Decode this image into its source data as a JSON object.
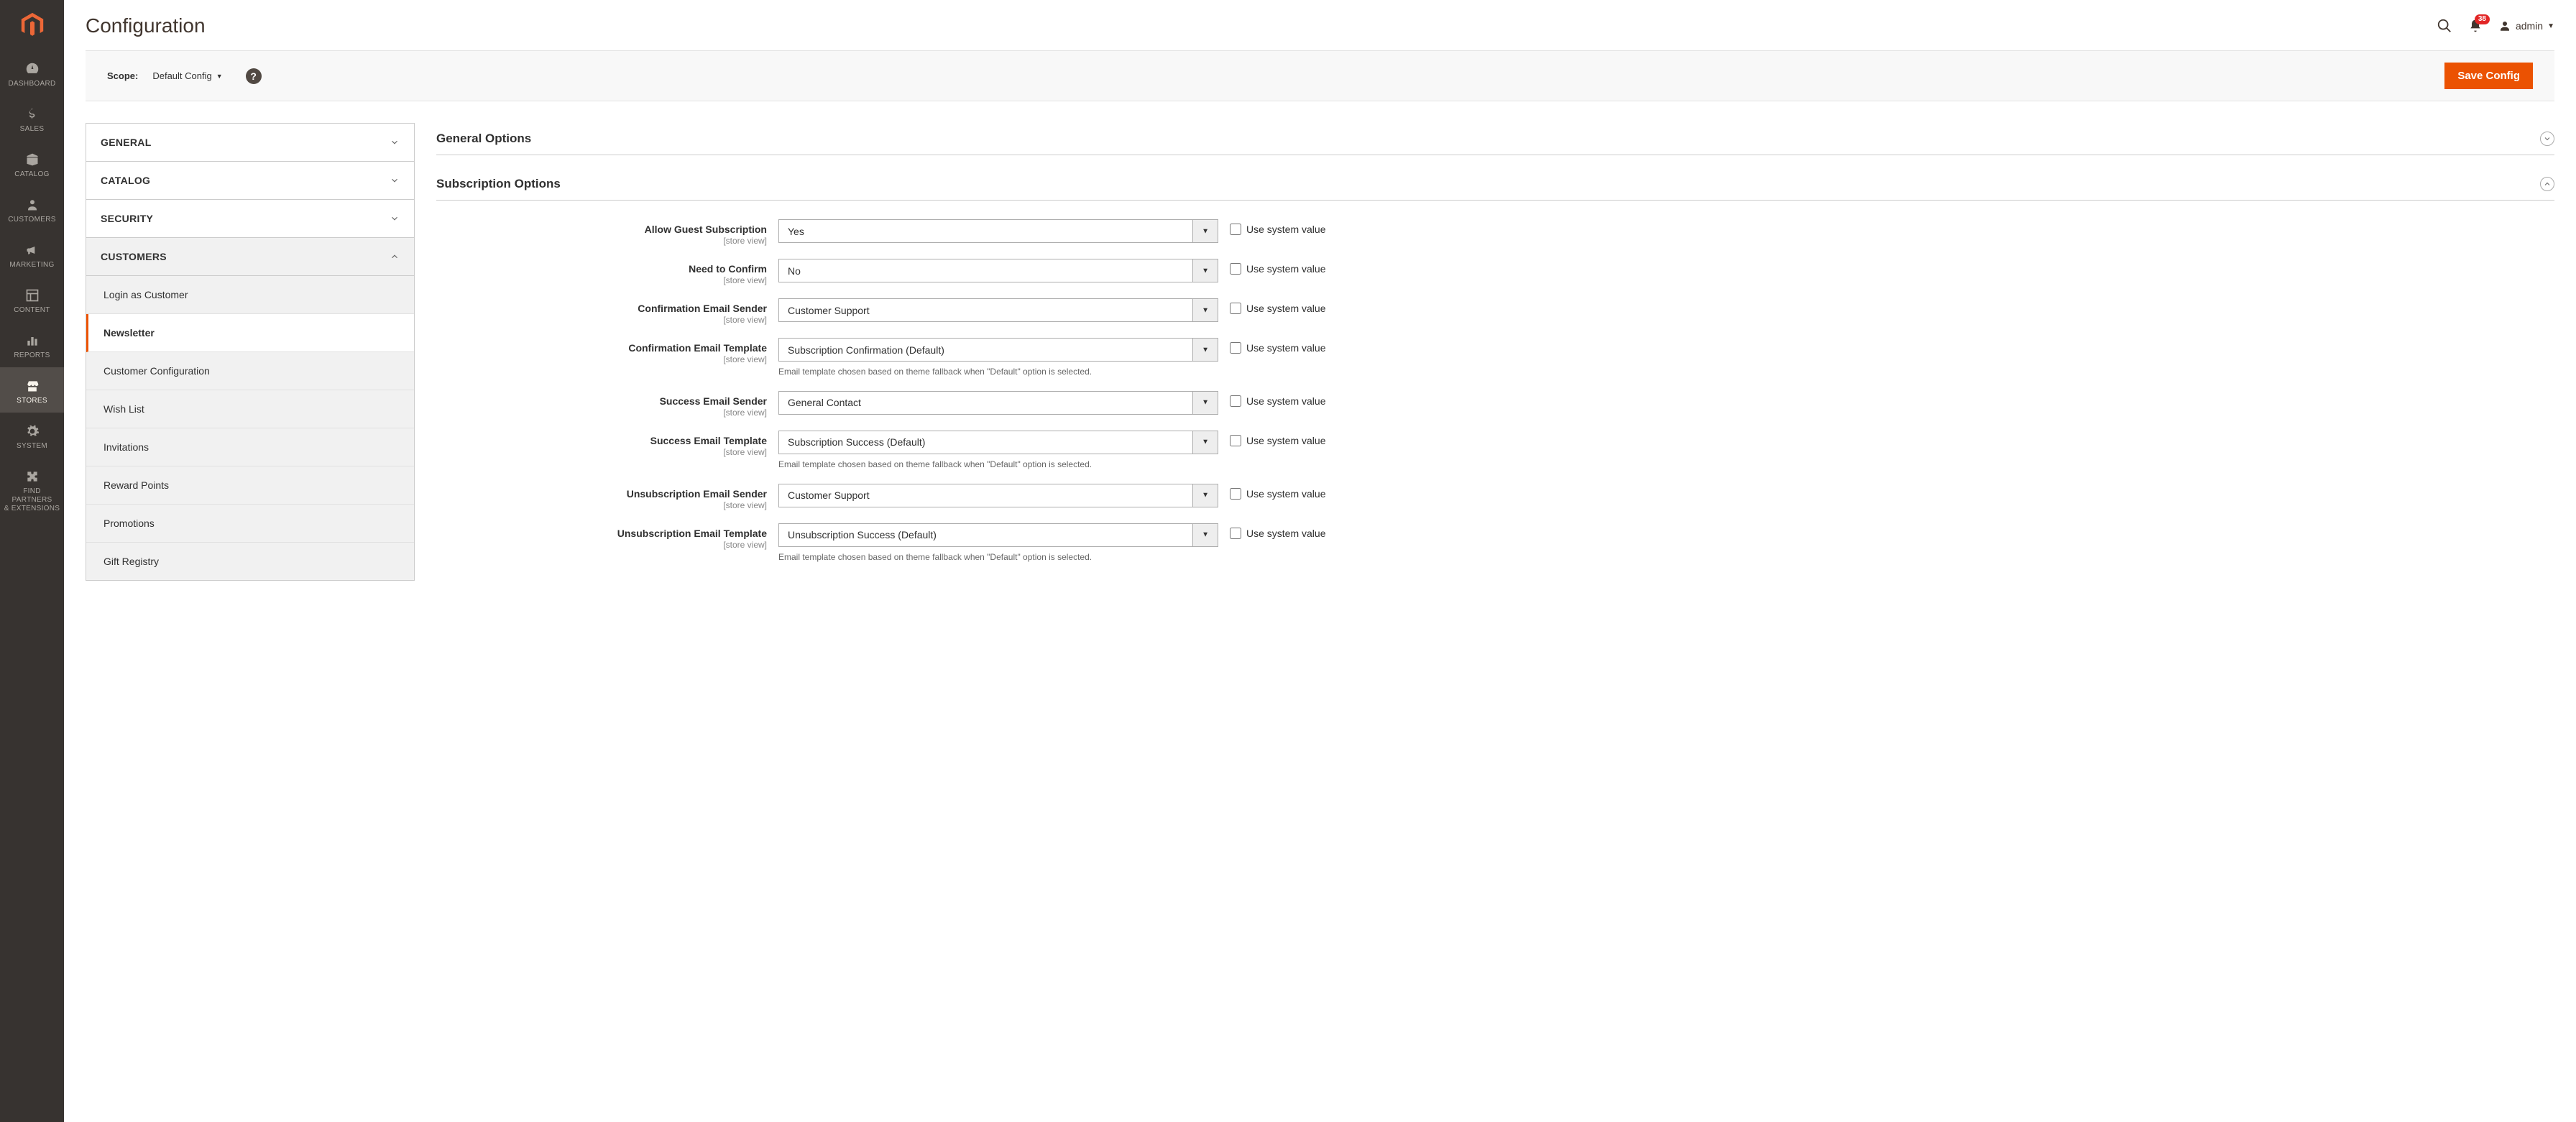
{
  "header": {
    "page_title": "Configuration",
    "notification_count": "38",
    "username": "admin"
  },
  "scope": {
    "label": "Scope:",
    "value": "Default Config"
  },
  "actions": {
    "save_label": "Save Config"
  },
  "menu": {
    "items": [
      {
        "label": "Dashboard"
      },
      {
        "label": "Sales"
      },
      {
        "label": "Catalog"
      },
      {
        "label": "Customers"
      },
      {
        "label": "Marketing"
      },
      {
        "label": "Content"
      },
      {
        "label": "Reports"
      },
      {
        "label": "Stores"
      },
      {
        "label": "System"
      },
      {
        "label": "Find Partners\n& Extensions"
      }
    ]
  },
  "config_nav": {
    "tabs": [
      {
        "label": "General",
        "expanded": false
      },
      {
        "label": "Catalog",
        "expanded": false
      },
      {
        "label": "Security",
        "expanded": false
      },
      {
        "label": "Customers",
        "expanded": true
      }
    ],
    "subitems": [
      {
        "label": "Login as Customer"
      },
      {
        "label": "Newsletter"
      },
      {
        "label": "Customer Configuration"
      },
      {
        "label": "Wish List"
      },
      {
        "label": "Invitations"
      },
      {
        "label": "Reward Points"
      },
      {
        "label": "Promotions"
      },
      {
        "label": "Gift Registry"
      }
    ]
  },
  "sections": {
    "general_options": "General Options",
    "subscription_options": "Subscription Options"
  },
  "fields": {
    "allow_guest": {
      "label": "Allow Guest Subscription",
      "scope": "[store view]",
      "value": "Yes"
    },
    "need_confirm": {
      "label": "Need to Confirm",
      "scope": "[store view]",
      "value": "No"
    },
    "confirm_sender": {
      "label": "Confirmation Email Sender",
      "scope": "[store view]",
      "value": "Customer Support"
    },
    "confirm_template": {
      "label": "Confirmation Email Template",
      "scope": "[store view]",
      "value": "Subscription Confirmation (Default)",
      "note": "Email template chosen based on theme fallback when \"Default\" option is selected."
    },
    "success_sender": {
      "label": "Success Email Sender",
      "scope": "[store view]",
      "value": "General Contact"
    },
    "success_template": {
      "label": "Success Email Template",
      "scope": "[store view]",
      "value": "Subscription Success (Default)",
      "note": "Email template chosen based on theme fallback when \"Default\" option is selected."
    },
    "unsub_sender": {
      "label": "Unsubscription Email Sender",
      "scope": "[store view]",
      "value": "Customer Support"
    },
    "unsub_template": {
      "label": "Unsubscription Email Template",
      "scope": "[store view]",
      "value": "Unsubscription Success (Default)",
      "note": "Email template chosen based on theme fallback when \"Default\" option is selected."
    }
  },
  "use_system_label": "Use system value"
}
